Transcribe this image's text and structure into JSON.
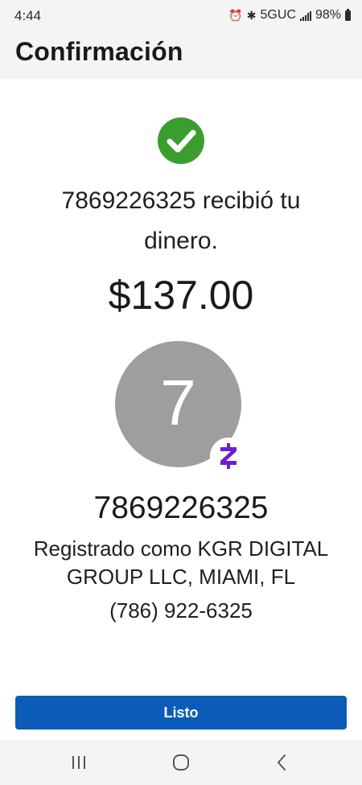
{
  "status_bar": {
    "time": "4:44",
    "network": "5GUC",
    "battery": "98%",
    "icons": [
      "alarm-icon",
      "bluetooth-icon",
      "signal-icon",
      "battery-icon"
    ]
  },
  "header": {
    "title": "Confirmación"
  },
  "confirmation": {
    "status_icon": "check-circle-icon",
    "message": "7869226325 recibió tu dinero.",
    "amount": "$137.00"
  },
  "recipient": {
    "avatar_initial": "7",
    "badge_icon": "zelle-icon",
    "name": "7869226325",
    "registered_as": "Registrado como KGR DIGITAL GROUP LLC, MIAMI, FL",
    "phone": "(786) 922-6325"
  },
  "actions": {
    "done_label": "Listo"
  },
  "nav": {
    "icons": [
      "recent-apps-icon",
      "home-icon",
      "back-icon"
    ]
  },
  "colors": {
    "success_green": "#3a9e2f",
    "button_blue": "#0a5cb8",
    "zelle_purple": "#6d1ed4",
    "avatar_gray": "#9e9e9e"
  }
}
